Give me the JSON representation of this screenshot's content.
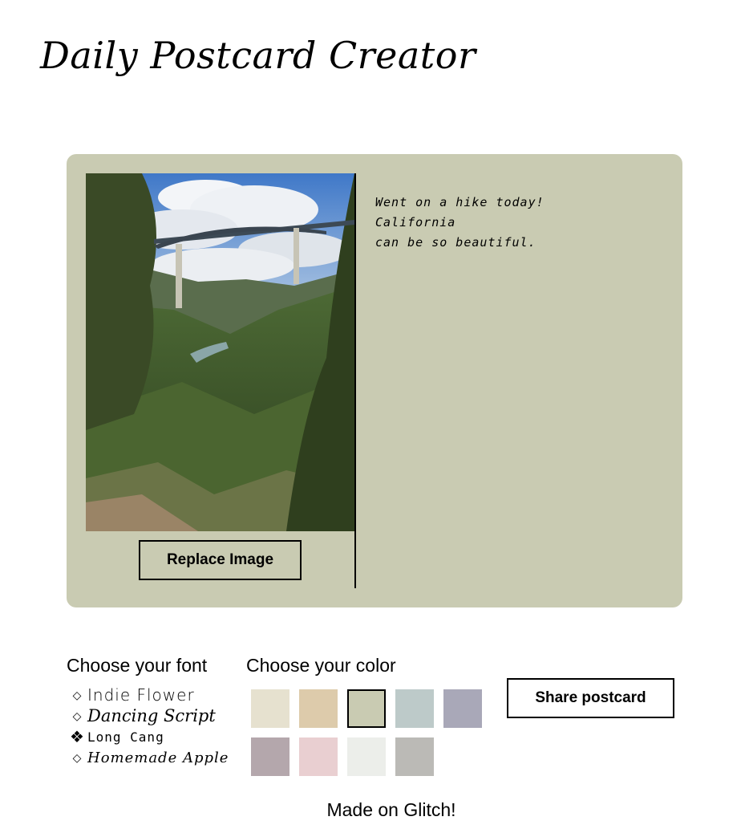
{
  "header": {
    "title": "Daily Postcard Creator"
  },
  "postcard": {
    "background_color": "#c9cbb2",
    "image_description_icon": "landscape-photo",
    "replace_button_label": "Replace Image",
    "message": "Went on a hike today! California\ncan be so beautiful."
  },
  "fonts": {
    "heading": "Choose your font",
    "options": [
      {
        "label": "Indie Flower",
        "selected": false
      },
      {
        "label": "Dancing Script",
        "selected": false
      },
      {
        "label": "Long Cang",
        "selected": true
      },
      {
        "label": "Homemade Apple",
        "selected": false
      }
    ],
    "bullet_unselected": "◇",
    "bullet_selected": "❖"
  },
  "colors": {
    "heading": "Choose your color",
    "swatches": [
      "#e6e1cf",
      "#ddcbab",
      "#c9cbb2",
      "#bdcac9",
      "#a9a8b8",
      "#b4a7ac",
      "#e9cfd1",
      "#eceeea",
      "#bbbab6"
    ],
    "selected_index": 2
  },
  "actions": {
    "share_label": "Share postcard"
  },
  "footer": {
    "text": "Made on Glitch!"
  }
}
